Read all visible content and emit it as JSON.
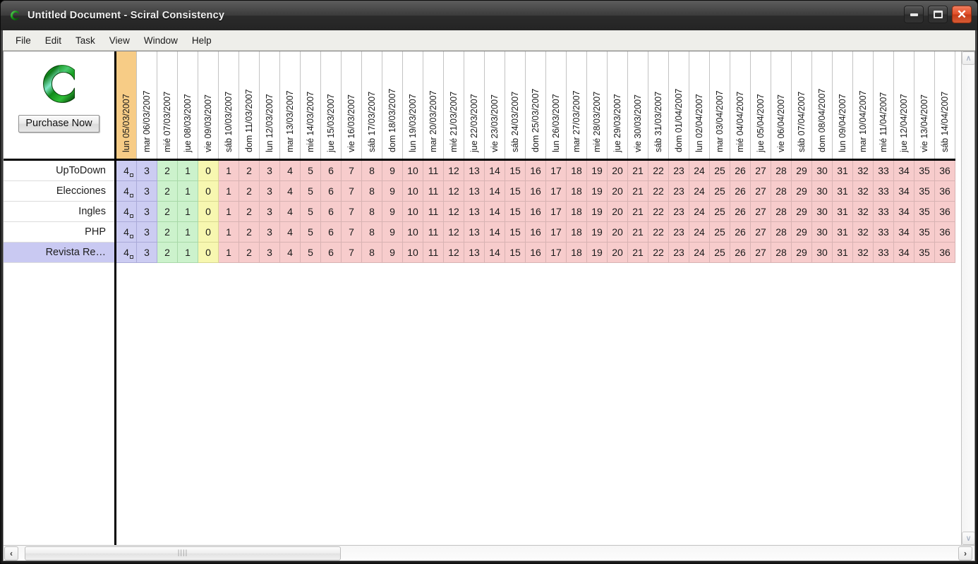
{
  "window": {
    "title": "Untitled Document - Sciral Consistency",
    "logo_icon": "sciral-c-logo-icon",
    "buttons": {
      "minimize": {
        "name": "minimize-button",
        "glyph": "minimize-icon"
      },
      "maximize": {
        "name": "maximize-button",
        "glyph": "maximize-icon"
      },
      "close": {
        "name": "close-button",
        "glyph": "close-icon",
        "label": "✕",
        "color": "#e2502a"
      }
    }
  },
  "menubar": {
    "items": [
      "File",
      "Edit",
      "Task",
      "View",
      "Window",
      "Help"
    ]
  },
  "sidebar": {
    "logo_icon": "sciral-c-logo-icon",
    "purchase_label": "Purchase Now"
  },
  "grid": {
    "today_index": 0,
    "column_headers": [
      "lun 05/03/2007",
      "mar 06/03/2007",
      "mié 07/03/2007",
      "jue 08/03/2007",
      "vie 09/03/2007",
      "sáb 10/03/2007",
      "dom 11/03/2007",
      "lun 12/03/2007",
      "mar 13/03/2007",
      "mié 14/03/2007",
      "jue 15/03/2007",
      "vie 16/03/2007",
      "sáb 17/03/2007",
      "dom 18/03/2007",
      "lun 19/03/2007",
      "mar 20/03/2007",
      "mié 21/03/2007",
      "jue 22/03/2007",
      "vie 23/03/2007",
      "sáb 24/03/2007",
      "dom 25/03/2007",
      "lun 26/03/2007",
      "mar 27/03/2007",
      "mié 28/03/2007",
      "jue 29/03/2007",
      "vie 30/03/2007",
      "sáb 31/03/2007",
      "dom 01/04/2007",
      "lun 02/04/2007",
      "mar 03/04/2007",
      "mié 04/04/2007",
      "jue 05/04/2007",
      "vie 06/04/2007",
      "sáb 07/04/2007",
      "dom 08/04/2007",
      "lun 09/04/2007",
      "mar 10/04/2007",
      "mié 11/04/2007",
      "jue 12/04/2007",
      "vie 13/04/2007",
      "sáb 14/04/2007"
    ],
    "row_values": [
      "4",
      "3",
      "2",
      "1",
      "0",
      "1",
      "2",
      "3",
      "4",
      "5",
      "6",
      "7",
      "8",
      "9",
      "10",
      "11",
      "12",
      "13",
      "14",
      "15",
      "16",
      "17",
      "18",
      "19",
      "20",
      "21",
      "22",
      "23",
      "24",
      "25",
      "26",
      "27",
      "28",
      "29",
      "30",
      "31",
      "32",
      "33",
      "34",
      "35",
      "36"
    ],
    "cell_colors": [
      "lav",
      "lav",
      "grn",
      "grn",
      "yel",
      "pnk",
      "pnk",
      "pnk",
      "pnk",
      "pnk",
      "pnk",
      "pnk",
      "pnk",
      "pnk",
      "pnk",
      "pnk",
      "pnk",
      "pnk",
      "pnk",
      "pnk",
      "pnk",
      "pnk",
      "pnk",
      "pnk",
      "pnk",
      "pnk",
      "pnk",
      "pnk",
      "pnk",
      "pnk",
      "pnk",
      "pnk",
      "pnk",
      "pnk",
      "pnk",
      "pnk",
      "pnk",
      "pnk",
      "pnk",
      "pnk",
      "pnk"
    ],
    "marker_column": 0,
    "rows": [
      {
        "label": "UpToDown",
        "selected": false
      },
      {
        "label": "Elecciones",
        "selected": false
      },
      {
        "label": "Ingles",
        "selected": false
      },
      {
        "label": "PHP",
        "selected": false
      },
      {
        "label": "Revista Re…",
        "selected": true
      }
    ]
  },
  "scrollbars": {
    "vertical": {
      "up_glyph": "∧",
      "down_glyph": "∨"
    },
    "horizontal": {
      "left_glyph": "‹",
      "right_glyph": "›",
      "thumb_grip": "||||"
    }
  },
  "colors": {
    "today_header": "#f7cc86",
    "cell_lavender": "#ccccf2",
    "cell_green": "#ccf2cc",
    "cell_yellow": "#f7f7b0",
    "cell_pink": "#f7cccc",
    "row_selected": "#c9c9f2",
    "logo_green": "#1ea024"
  }
}
